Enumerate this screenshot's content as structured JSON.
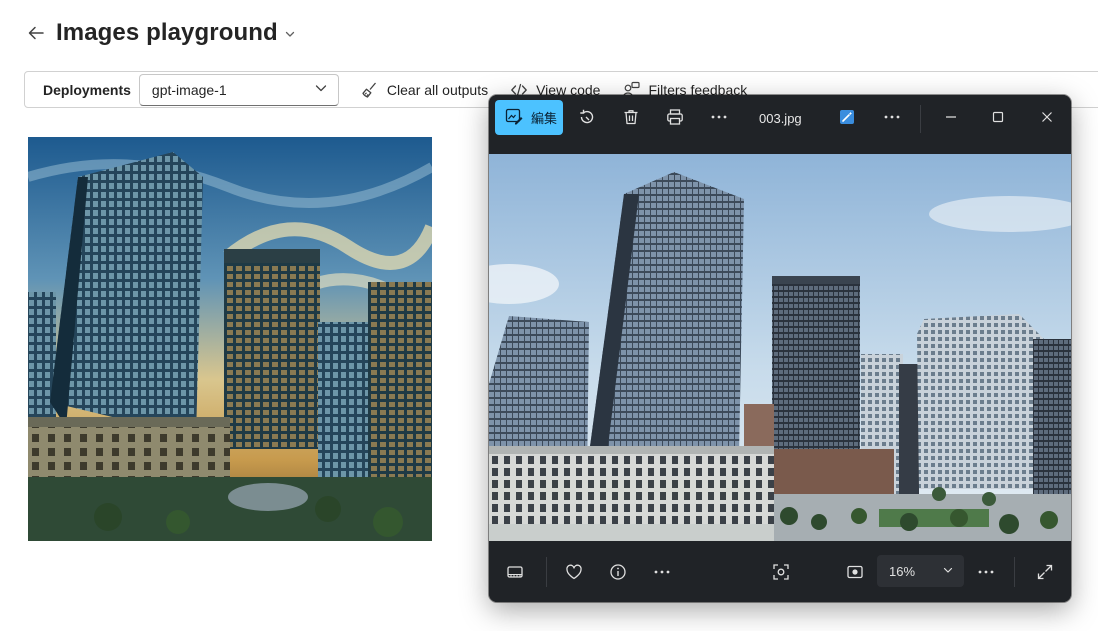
{
  "header": {
    "title": "Images playground"
  },
  "toolbar": {
    "deployments_label": "Deployments",
    "deployment_value": "gpt-image-1",
    "clear_label": "Clear all outputs",
    "view_code_label": "View code",
    "filters_label": "Filters feedback"
  },
  "viewer": {
    "edit_label": "編集",
    "filename": "003.jpg",
    "zoom": "16%",
    "accent_color": "#4cc2ff"
  },
  "icons": {
    "back": "arrow-left-icon",
    "chevron": "chevron-down-icon",
    "broom": "broom-icon",
    "code": "code-icon",
    "feedback": "person-feedback-icon",
    "edit": "image-edit-icon",
    "rotate": "rotate-icon",
    "delete": "trash-icon",
    "print": "print-icon",
    "more": "more-icon",
    "enhance": "wand-icon",
    "minimize": "minimize-icon",
    "maximize": "maximize-icon",
    "close": "close-icon",
    "filmstrip": "filmstrip-icon",
    "favorite": "heart-icon",
    "info": "info-icon",
    "crop": "crop-focus-icon",
    "actual-size": "actual-size-icon",
    "fullscreen": "fullscreen-icon"
  }
}
